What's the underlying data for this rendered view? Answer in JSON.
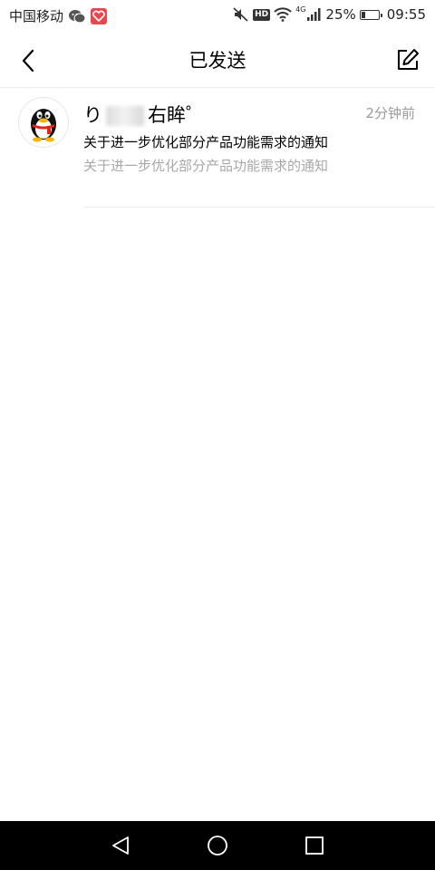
{
  "status_bar": {
    "carrier": "中国移动",
    "hd_label": "HD",
    "network_gen": "4G",
    "battery_percent": "25%",
    "battery_level": 0.25,
    "time": "09:55",
    "icons": [
      "wechat-icon",
      "heart-app-icon",
      "mute-icon",
      "wifi-icon",
      "signal-icon",
      "battery-icon"
    ]
  },
  "nav": {
    "title": "已发送",
    "back_icon": "back-arrow-icon",
    "compose_icon": "compose-icon"
  },
  "mail_list": [
    {
      "sender_prefix": "り",
      "sender_suffix": "右眸゜",
      "time": "2分钟前",
      "subject": "关于进一步优化部分产品功能需求的通知",
      "preview": "关于进一步优化部分产品功能需求的通知",
      "avatar": "qq-penguin-avatar"
    }
  ],
  "system_nav": {
    "icons": [
      "nav-back-icon",
      "nav-home-icon",
      "nav-recent-icon"
    ]
  },
  "colors": {
    "background": "#ffffff",
    "secondary_text": "#a8a8a8",
    "divider": "#ececec",
    "system_nav": "#000000"
  }
}
